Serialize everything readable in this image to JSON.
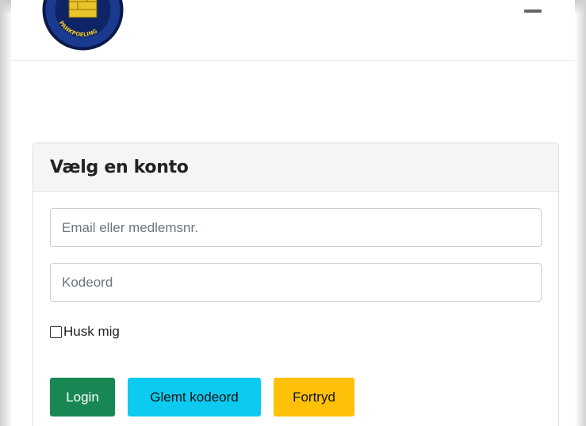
{
  "logo": {
    "text": "PANKPOELING",
    "colors": {
      "ring": "#1a3a8f",
      "ring_edge": "#0b1a4a",
      "tower": "#e9c52b"
    }
  },
  "header": {
    "menu_icon": "menu-icon"
  },
  "login_card": {
    "title": "Vælg en konto",
    "email_placeholder": "Email eller medlemsnr.",
    "password_placeholder": "Kodeord",
    "remember_label": "Husk mig",
    "login_button": "Login",
    "forgot_button": "Glemt kodeord",
    "cancel_button": "Fortryd"
  },
  "colors": {
    "login": "#198754",
    "forgot": "#0dcaf0",
    "cancel": "#ffc107"
  }
}
